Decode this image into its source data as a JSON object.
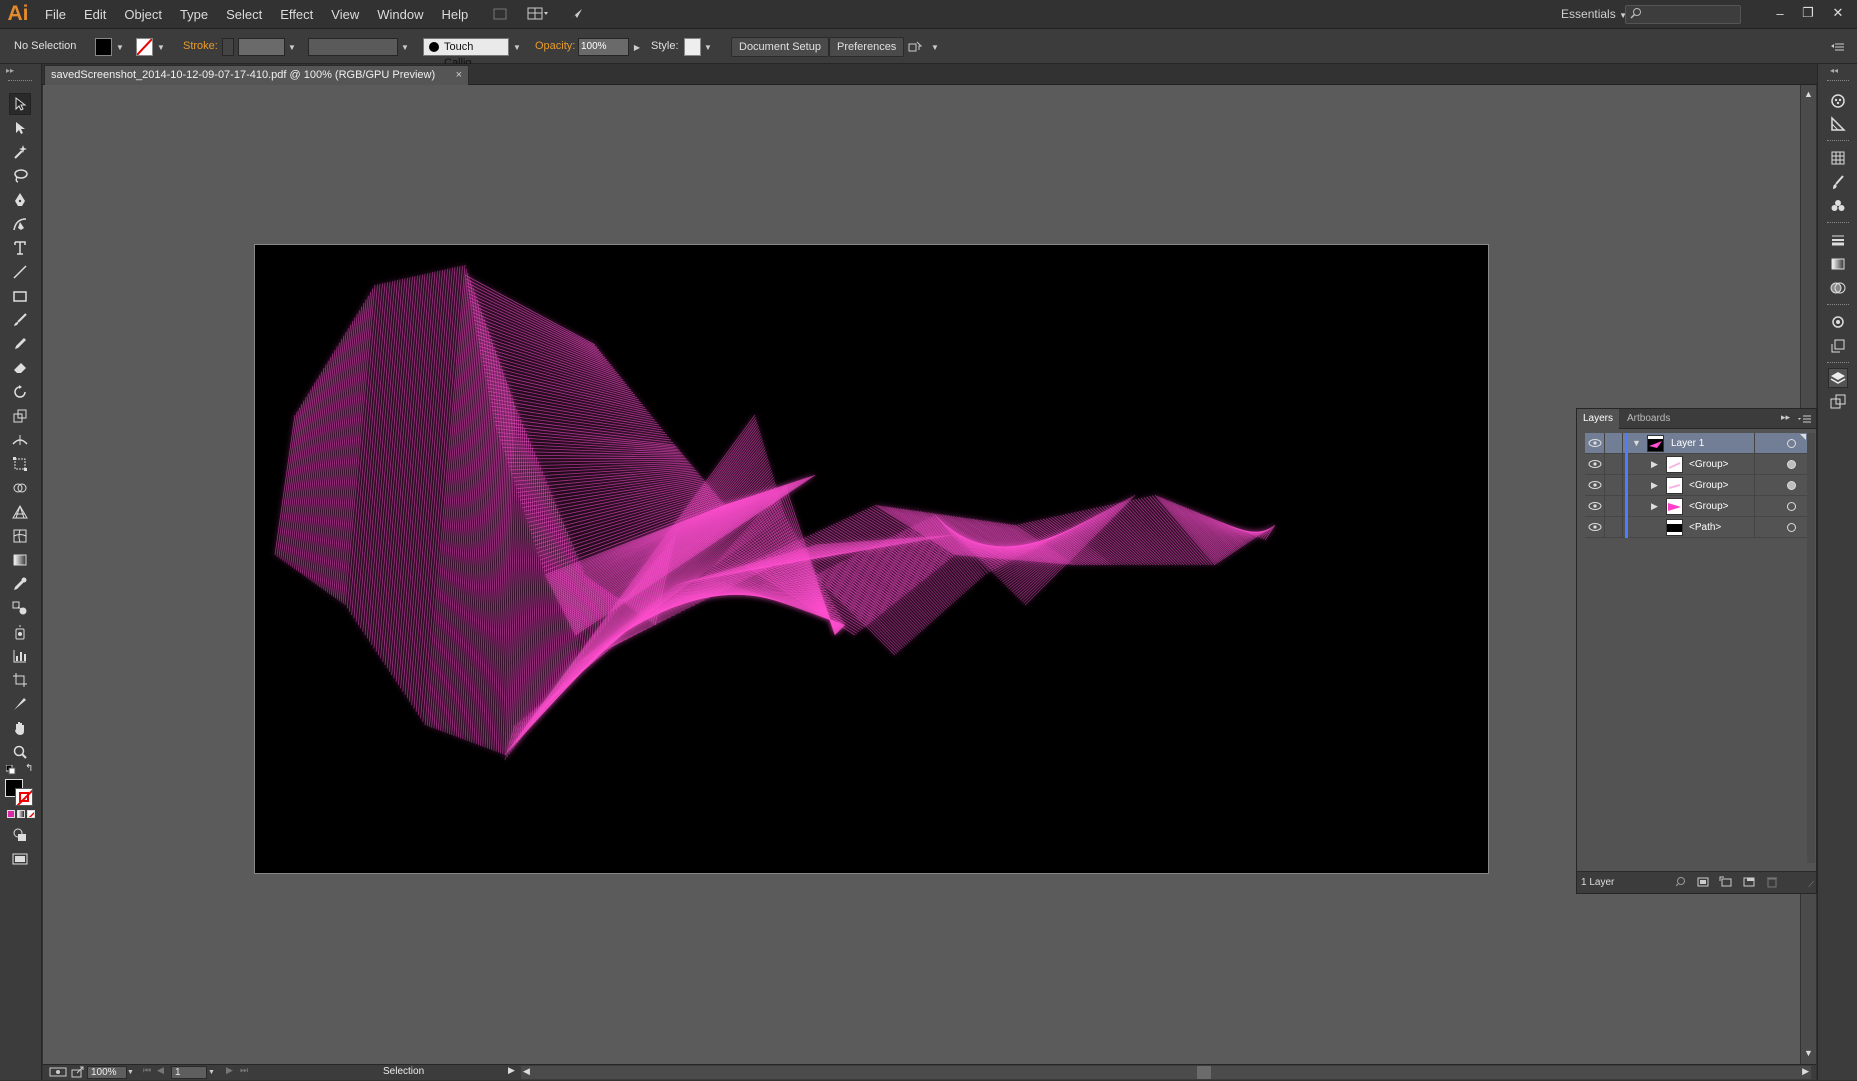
{
  "app": {
    "logo": "Ai"
  },
  "menu": [
    "File",
    "Edit",
    "Object",
    "Type",
    "Select",
    "Effect",
    "View",
    "Window",
    "Help"
  ],
  "workspace": {
    "label": "Essentials",
    "search_placeholder": ""
  },
  "control_bar": {
    "selection_label": "No Selection",
    "stroke_label": "Stroke:",
    "brush_label": "Touch Callig...",
    "opacity_label": "Opacity:",
    "opacity_value": "100%",
    "style_label": "Style:",
    "document_setup": "Document Setup",
    "preferences": "Preferences"
  },
  "document": {
    "tab_title": "savedScreenshot_2014-10-12-09-07-17-410.pdf @ 100% (RGB/GPU Preview)",
    "close_glyph": "×"
  },
  "artwork": {
    "stroke_color": "#ff4fd0",
    "background": "#000000"
  },
  "layers_panel": {
    "tabs": [
      "Layers",
      "Artboards"
    ],
    "rows": [
      {
        "name": "Layer 1",
        "selected": true,
        "expanded": true
      },
      {
        "name": "<Group>",
        "selected": false
      },
      {
        "name": "<Group>",
        "selected": false
      },
      {
        "name": "<Group>",
        "selected": false
      },
      {
        "name": "<Path>",
        "selected": false
      }
    ],
    "footer": "1 Layer"
  },
  "status_bar": {
    "zoom": "100%",
    "artboard_number": "1",
    "tool_status": "Selection"
  },
  "colors": {
    "accent": "#e89a2a",
    "selection": "#727e95",
    "layer_color": "#4f7cff"
  }
}
